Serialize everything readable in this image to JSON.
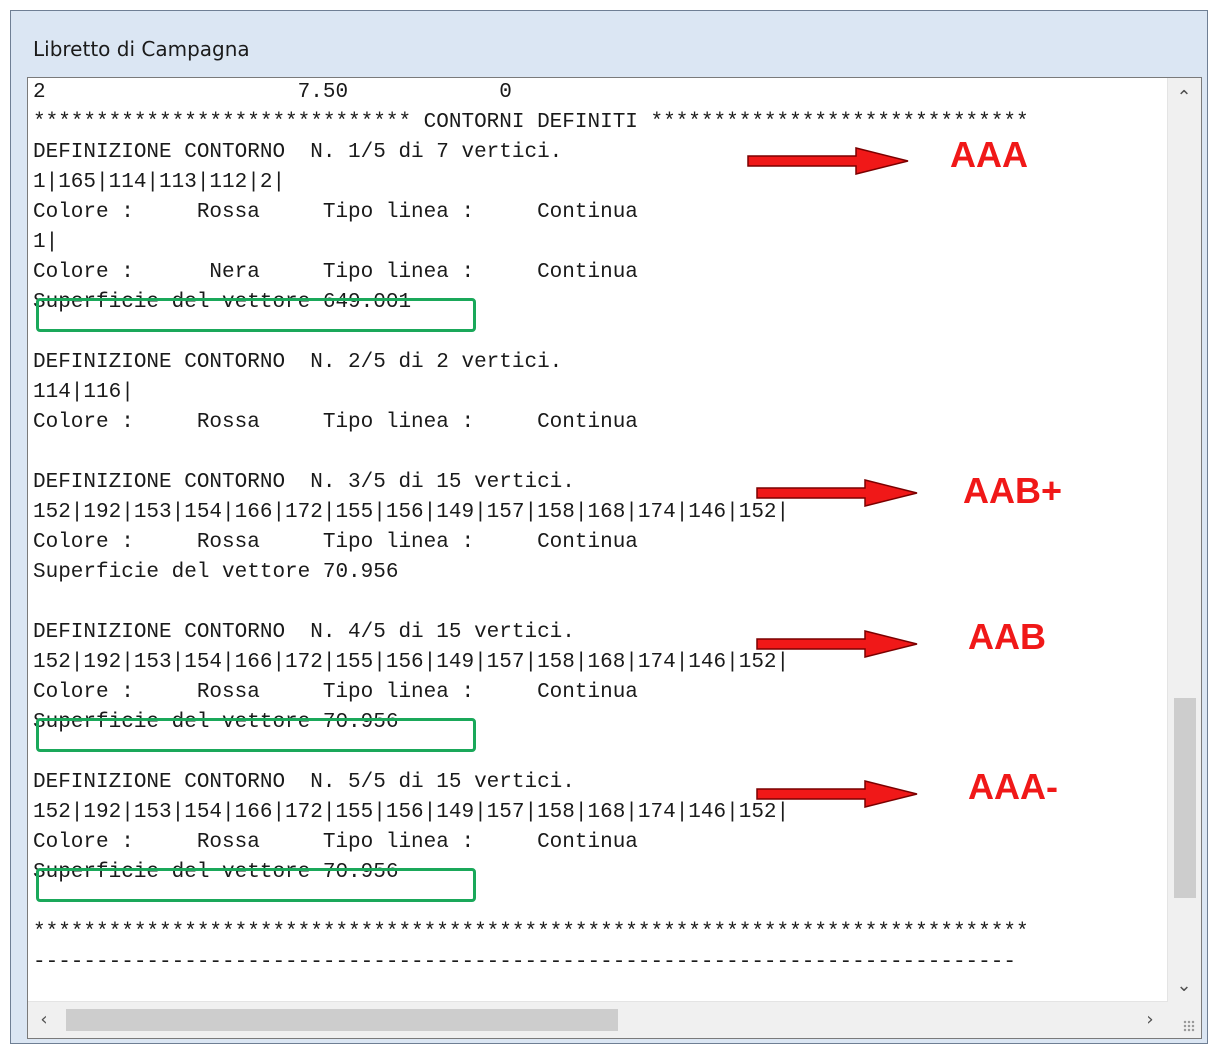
{
  "window": {
    "title": "Libretto di Campagna"
  },
  "log": {
    "lines": [
      "2                    7.50            0",
      "****************************** CONTORNI DEFINITI ******************************",
      "DEFINIZIONE CONTORNO  N. 1/5 di 7 vertici.",
      "1|165|114|113|112|2|",
      "Colore :     Rossa     Tipo linea :     Continua",
      "1|",
      "Colore :      Nera     Tipo linea :     Continua",
      "Superficie del vettore 649.001",
      "",
      "DEFINIZIONE CONTORNO  N. 2/5 di 2 vertici.",
      "114|116|",
      "Colore :     Rossa     Tipo linea :     Continua",
      "",
      "DEFINIZIONE CONTORNO  N. 3/5 di 15 vertici.",
      "152|192|153|154|166|172|155|156|149|157|158|168|174|146|152|",
      "Colore :     Rossa     Tipo linea :     Continua",
      "Superficie del vettore 70.956",
      "",
      "DEFINIZIONE CONTORNO  N. 4/5 di 15 vertici.",
      "152|192|153|154|166|172|155|156|149|157|158|168|174|146|152|",
      "Colore :     Rossa     Tipo linea :     Continua",
      "Superficie del vettore 70.956",
      "",
      "DEFINIZIONE CONTORNO  N. 5/5 di 15 vertici.",
      "152|192|153|154|166|172|155|156|149|157|158|168|174|146|152|",
      "Colore :     Rossa     Tipo linea :     Continua",
      "Superficie del vettore 70.956",
      "",
      "*******************************************************************************",
      "------------------------------------------------------------------------------"
    ]
  },
  "annotations": {
    "labels": [
      "AAA",
      "AAB+",
      "AAB",
      "AAA-"
    ],
    "color": "#f01818",
    "highlight_color": "#1aa85a"
  },
  "scrollbars": {
    "up_icon": "chevron-up-icon",
    "down_icon": "chevron-down-icon",
    "left_icon": "chevron-left-icon",
    "right_icon": "chevron-right-icon"
  }
}
